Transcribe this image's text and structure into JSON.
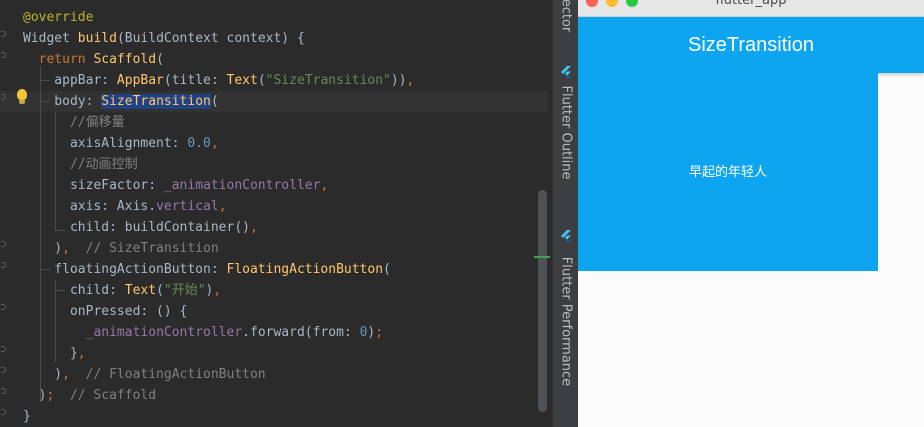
{
  "editor": {
    "lines": [
      [
        {
          "c": "t-ann",
          "t": "@override"
        }
      ],
      [
        {
          "c": "t-id",
          "t": "Widget "
        },
        {
          "c": "t-fn",
          "t": "build"
        },
        {
          "c": "t-id",
          "t": "(BuildContext context) {"
        }
      ],
      [
        {
          "c": "t-id",
          "t": "  "
        },
        {
          "c": "t-kw",
          "t": "return "
        },
        {
          "c": "t-fn",
          "t": "Scaffold"
        },
        {
          "c": "t-id",
          "t": "("
        }
      ],
      [
        {
          "c": "t-id",
          "t": "    appBar: "
        },
        {
          "c": "t-fn",
          "t": "AppBar"
        },
        {
          "c": "t-id",
          "t": "(title: "
        },
        {
          "c": "t-fn",
          "t": "Text"
        },
        {
          "c": "t-id",
          "t": "("
        },
        {
          "c": "t-str",
          "t": "\"SizeTransition\""
        },
        {
          "c": "t-id",
          "t": "))"
        },
        {
          "c": "t-kw",
          "t": ","
        }
      ],
      [
        {
          "c": "t-id",
          "t": "    body: "
        },
        {
          "c": "t-fn t-sel",
          "t": "SizeTransition"
        },
        {
          "c": "t-id",
          "t": "("
        }
      ],
      [
        {
          "c": "t-cm",
          "t": "      //偏移量"
        }
      ],
      [
        {
          "c": "t-id",
          "t": "      axisAlignment: "
        },
        {
          "c": "t-num",
          "t": "0.0"
        },
        {
          "c": "t-kw",
          "t": ","
        }
      ],
      [
        {
          "c": "t-cm",
          "t": "      //动画控制"
        }
      ],
      [
        {
          "c": "t-id",
          "t": "      sizeFactor: "
        },
        {
          "c": "t-field",
          "t": "_animationController"
        },
        {
          "c": "t-kw",
          "t": ","
        }
      ],
      [
        {
          "c": "t-id",
          "t": "      axis: Axis."
        },
        {
          "c": "t-field",
          "t": "vertical"
        },
        {
          "c": "t-kw",
          "t": ","
        }
      ],
      [
        {
          "c": "t-id",
          "t": "      child: buildContainer()"
        },
        {
          "c": "t-kw",
          "t": ","
        }
      ],
      [
        {
          "c": "t-id",
          "t": "    )"
        },
        {
          "c": "t-kw",
          "t": ","
        },
        {
          "c": "t-cm",
          "t": "  // SizeTransition"
        }
      ],
      [
        {
          "c": "t-id",
          "t": "    floatingActionButton: "
        },
        {
          "c": "t-fn",
          "t": "FloatingActionButton"
        },
        {
          "c": "t-id",
          "t": "("
        }
      ],
      [
        {
          "c": "t-id",
          "t": "      child: "
        },
        {
          "c": "t-fn",
          "t": "Text"
        },
        {
          "c": "t-id",
          "t": "("
        },
        {
          "c": "t-str",
          "t": "\"开始\""
        },
        {
          "c": "t-id",
          "t": ")"
        },
        {
          "c": "t-kw",
          "t": ","
        }
      ],
      [
        {
          "c": "t-id",
          "t": "      onPressed: () {"
        }
      ],
      [
        {
          "c": "t-id",
          "t": "        "
        },
        {
          "c": "t-field",
          "t": "_animationController"
        },
        {
          "c": "t-id",
          "t": ".forward(from: "
        },
        {
          "c": "t-num",
          "t": "0"
        },
        {
          "c": "t-id",
          "t": ")"
        },
        {
          "c": "t-kw",
          "t": ";"
        }
      ],
      [
        {
          "c": "t-id",
          "t": "      }"
        },
        {
          "c": "t-kw",
          "t": ","
        }
      ],
      [
        {
          "c": "t-id",
          "t": "    )"
        },
        {
          "c": "t-kw",
          "t": ","
        },
        {
          "c": "t-cm",
          "t": "  // FloatingActionButton"
        }
      ],
      [
        {
          "c": "t-id",
          "t": "  )"
        },
        {
          "c": "t-kw",
          "t": ";"
        },
        {
          "c": "t-cm",
          "t": "  // Scaffold"
        }
      ],
      [
        {
          "c": "t-id",
          "t": "}"
        }
      ]
    ]
  },
  "tool_strip": {
    "top_label": "ector",
    "flutter_outline": "Flutter Outline",
    "flutter_performance": "Flutter Performance",
    "icon": "flutter-icon"
  },
  "simulator": {
    "window_title": "flutter_app",
    "appbar_title": "SizeTransition",
    "box_text": "早起的年轻人",
    "colors": {
      "primary": "#0da5ef",
      "background": "#fafafa",
      "close": "#fe5f57",
      "minimize": "#febc2e",
      "zoom": "#28c840"
    }
  }
}
